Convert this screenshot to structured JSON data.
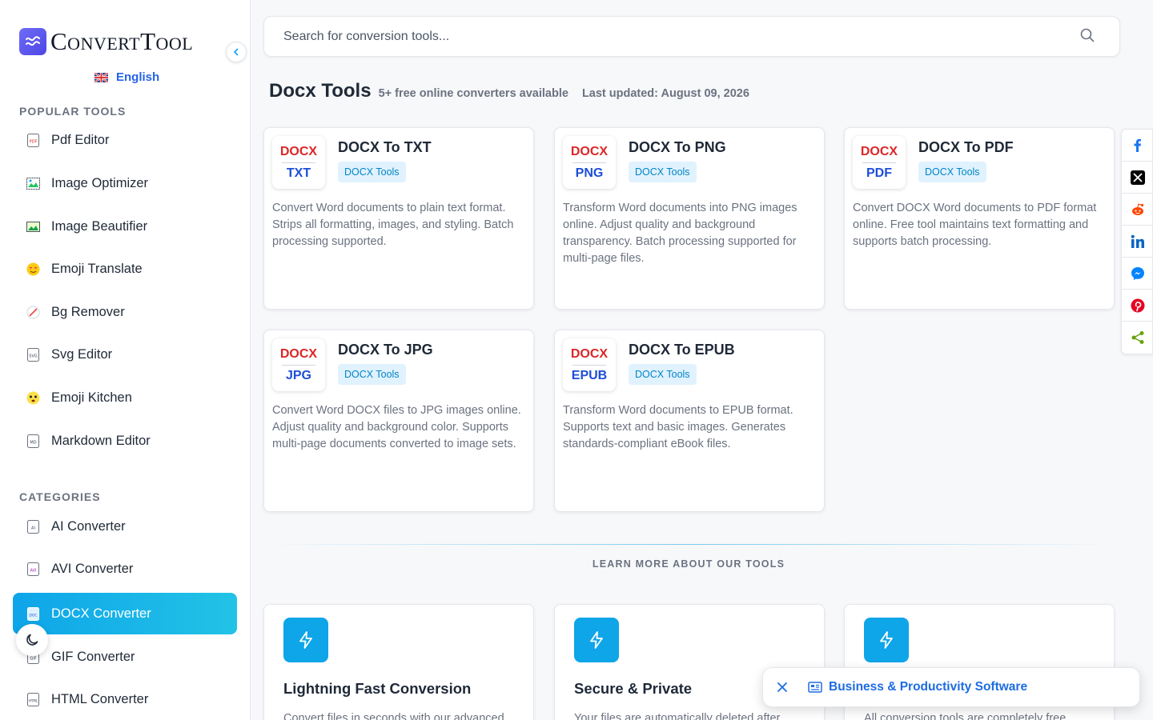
{
  "sidebar": {
    "logo_text": "ConvertTool",
    "language": "English",
    "popular_title": "POPULAR TOOLS",
    "popular": [
      {
        "label": "Pdf Editor",
        "icon": "pdf-file-icon"
      },
      {
        "label": "Image Optimizer",
        "icon": "image-optimizer-icon"
      },
      {
        "label": "Image Beautifier",
        "icon": "image-icon"
      },
      {
        "label": "Emoji Translate",
        "icon": "emoji-heart-eyes-icon"
      },
      {
        "label": "Bg Remover",
        "icon": "no-background-icon"
      },
      {
        "label": "Svg Editor",
        "icon": "svg-file-icon"
      },
      {
        "label": "Emoji Kitchen",
        "icon": "emoji-icon"
      },
      {
        "label": "Markdown Editor",
        "icon": "md-file-icon"
      }
    ],
    "categories_title": "CATEGORIES",
    "categories": [
      {
        "label": "AI Converter",
        "icon": "ai-file-icon"
      },
      {
        "label": "AVI Converter",
        "icon": "avi-file-icon"
      },
      {
        "label": "DOCX Converter",
        "icon": "docx-file-icon",
        "active": true
      },
      {
        "label": "GIF Converter",
        "icon": "gif-file-icon"
      },
      {
        "label": "HTML Converter",
        "icon": "html-file-icon"
      }
    ]
  },
  "search": {
    "placeholder": "Search for conversion tools..."
  },
  "page": {
    "title": "Docx Tools",
    "subtitle": "5+ free online converters available",
    "updated": "Last updated: August 09, 2026"
  },
  "tools": [
    {
      "from": "DOCX",
      "to": "TXT",
      "title": "DOCX To TXT",
      "tag": "DOCX Tools",
      "desc": "Convert Word documents to plain text format. Strips all formatting, images, and styling. Batch processing supported."
    },
    {
      "from": "DOCX",
      "to": "PNG",
      "title": "DOCX To PNG",
      "tag": "DOCX Tools",
      "desc": "Transform Word documents into PNG images online. Adjust quality and background transparency. Batch processing supported for multi-page files."
    },
    {
      "from": "DOCX",
      "to": "PDF",
      "title": "DOCX To PDF",
      "tag": "DOCX Tools",
      "desc": "Convert DOCX Word documents to PDF format online. Free tool maintains text formatting and supports batch processing."
    },
    {
      "from": "DOCX",
      "to": "JPG",
      "title": "DOCX To JPG",
      "tag": "DOCX Tools",
      "desc": "Convert Word DOCX files to JPG images online. Adjust quality and background color. Supports multi-page documents converted to image sets."
    },
    {
      "from": "DOCX",
      "to": "EPUB",
      "title": "DOCX To EPUB",
      "tag": "DOCX Tools",
      "desc": "Transform Word documents to EPUB format. Supports text and basic images. Generates standards-compliant eBook files."
    }
  ],
  "learn_more": "LEARN MORE ABOUT OUR TOOLS",
  "features": [
    {
      "title": "Lightning Fast Conversion",
      "desc": "Convert files in seconds with our advanced",
      "icon": "lightning-icon"
    },
    {
      "title": "Secure & Private",
      "desc": "Your files are automatically deleted after",
      "icon": "lightning-icon"
    },
    {
      "title": "",
      "desc": "All conversion tools are completely free",
      "icon": "lightning-icon"
    }
  ],
  "share": [
    "facebook-icon",
    "x-icon",
    "reddit-icon",
    "linkedin-icon",
    "messenger-icon",
    "pinterest-icon",
    "share-icon"
  ],
  "toast": {
    "label": "Business & Productivity Software"
  },
  "colors": {
    "accent": "#0ea5e9",
    "link": "#2563eb",
    "badge_from": "#dc2626",
    "badge_to": "#1d4ed8"
  }
}
